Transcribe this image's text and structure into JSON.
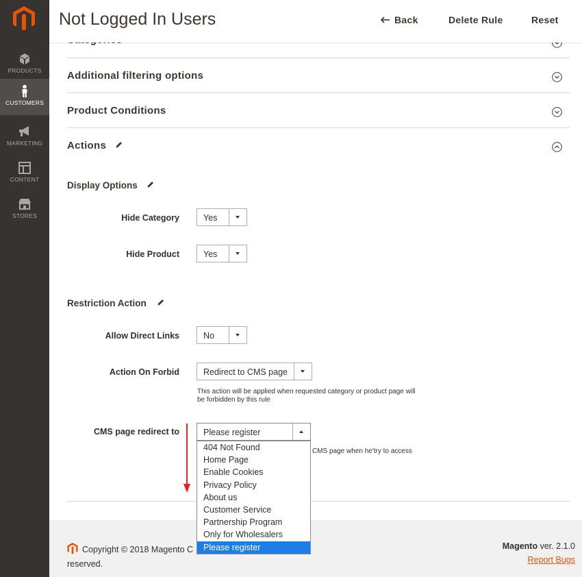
{
  "colors": {
    "sidebar_bg": "#373330",
    "accent": "#eb5202",
    "selected_option": "#1e7ee5",
    "arrow": "#e22626"
  },
  "sidebar": {
    "items": [
      {
        "label": "PRODUCTS",
        "icon": "box-icon"
      },
      {
        "label": "CUSTOMERS",
        "icon": "person-icon"
      },
      {
        "label": "MARKETING",
        "icon": "megaphone-icon"
      },
      {
        "label": "CONTENT",
        "icon": "layout-icon"
      },
      {
        "label": "STORES",
        "icon": "store-icon"
      }
    ]
  },
  "header": {
    "title": "Not Logged In Users",
    "back_label": "Back",
    "delete_label": "Delete Rule",
    "reset_label": "Reset"
  },
  "sections": [
    {
      "title": "Categories"
    },
    {
      "title": "Additional filtering options"
    },
    {
      "title": "Product Conditions"
    },
    {
      "title": "Actions"
    }
  ],
  "display_options": {
    "title": "Display Options",
    "hide_category": {
      "label": "Hide Category",
      "value": "Yes"
    },
    "hide_product": {
      "label": "Hide Product",
      "value": "Yes"
    }
  },
  "restriction_action": {
    "title": "Restriction Action",
    "allow_direct_links": {
      "label": "Allow Direct Links",
      "value": "No"
    },
    "action_on_forbid": {
      "label": "Action On Forbid",
      "value": "Redirect to CMS page",
      "note_line1": "This action will be applied when requested category or product page will",
      "note_line2": "be forbidden by this rule"
    },
    "cms_redirect": {
      "label": "CMS page redirect to",
      "value": "Please register",
      "note": "CMS page when he'try to access",
      "options": [
        "404 Not Found",
        "Home Page",
        "Enable Cookies",
        "Privacy Policy",
        "About us",
        "Customer Service",
        "Partnership Program",
        "Only for Wholesalers",
        "Please register"
      ],
      "selected_index": 8
    }
  },
  "footer": {
    "copyright_line1": "Copyright © 2018 Magento C",
    "copyright_line2": "reserved.",
    "brand": "Magento",
    "version": " ver. 2.1.0",
    "report_bugs": "Report Bugs"
  }
}
